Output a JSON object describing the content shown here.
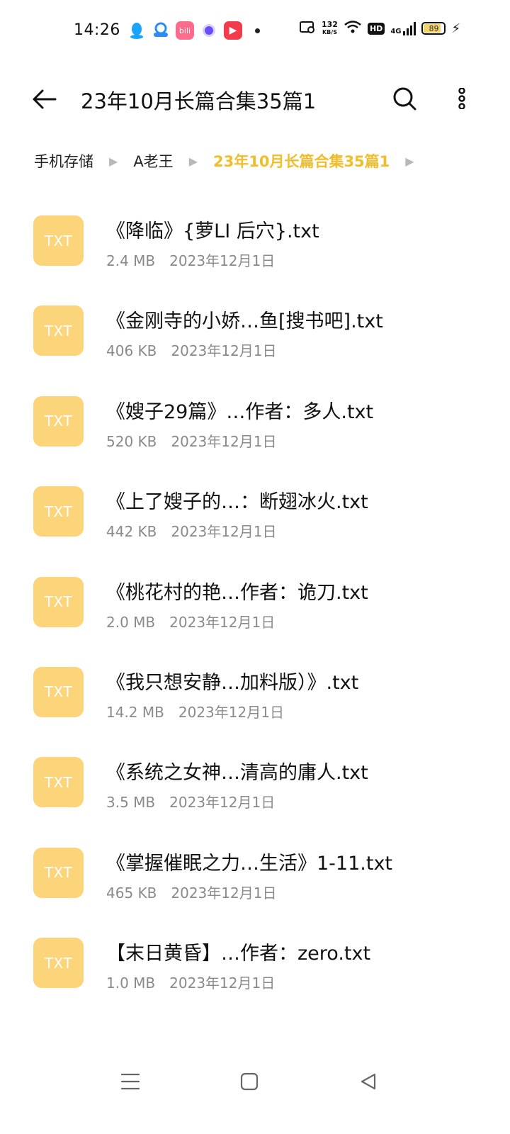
{
  "status_bar": {
    "time": "14:26",
    "net_speed_value": "132",
    "net_speed_unit": "KB/S",
    "hd_label": "HD",
    "network_type": "4G",
    "battery": "89",
    "app_icons": [
      "qq-icon",
      "cloud-app-icon",
      "bilibili-icon",
      "purple-app-icon",
      "video-app-icon"
    ],
    "bilibili_label": "bili",
    "colors": {
      "qq": "#1aa3ff",
      "pink": "#ff6b8a",
      "purple": "#6b4cff",
      "red": "#f23b4b",
      "battery_fill": "#f5d36c"
    }
  },
  "header": {
    "title": "23年10月长篇合集35篇1"
  },
  "breadcrumb": {
    "items": [
      {
        "label": "手机存储"
      },
      {
        "label": "A老王"
      },
      {
        "label": "23年10月长篇合集35篇1"
      }
    ],
    "active_color": "#f0bd2c"
  },
  "files": [
    {
      "icon_label": "TXT",
      "name": "《降临》{萝LI 后穴}.txt",
      "size": "2.4 MB",
      "date": "2023年12月1日"
    },
    {
      "icon_label": "TXT",
      "name": "《金刚寺的小娇…鱼[搜书吧].txt",
      "size": "406 KB",
      "date": "2023年12月1日"
    },
    {
      "icon_label": "TXT",
      "name": "《嫂子29篇》…作者：多人.txt",
      "size": "520 KB",
      "date": "2023年12月1日"
    },
    {
      "icon_label": "TXT",
      "name": "《上了嫂子的…：断翅冰火.txt",
      "size": "442 KB",
      "date": "2023年12月1日"
    },
    {
      "icon_label": "TXT",
      "name": "《桃花村的艳…作者：诡刀.txt",
      "size": "2.0 MB",
      "date": "2023年12月1日"
    },
    {
      "icon_label": "TXT",
      "name": "《我只想安静…加料版）》.txt",
      "size": "14.2 MB",
      "date": "2023年12月1日"
    },
    {
      "icon_label": "TXT",
      "name": "《系统之女神…清高的庸人.txt",
      "size": "3.5 MB",
      "date": "2023年12月1日"
    },
    {
      "icon_label": "TXT",
      "name": "《掌握催眠之力…生活》1-11.txt",
      "size": "465 KB",
      "date": "2023年12月1日"
    },
    {
      "icon_label": "TXT",
      "name": "【末日黄昏】…作者：zero.txt",
      "size": "1.0 MB",
      "date": "2023年12月1日"
    }
  ],
  "file_icon_color": "#fcd47a",
  "navbar": {
    "buttons": [
      "menu-icon",
      "home-icon",
      "back-triangle-icon"
    ]
  }
}
